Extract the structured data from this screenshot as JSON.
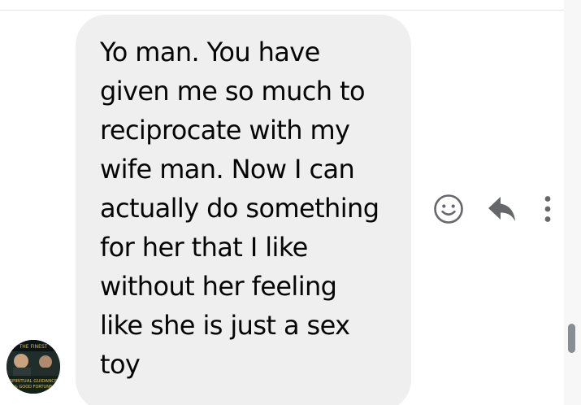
{
  "message": {
    "text": "Yo man. You have\ngiven me so much to\nreciprocate with my\nwife man. Now I can\nactually do something\nfor her that I like\nwithout her feeling\nlike she is just a sex\ntoy"
  },
  "avatar": {
    "logo_text_top": "THE FINEST",
    "logo_text_middle": "SPIRITUAL GUIDANCE",
    "logo_text_bottom": "& GOOD FORTUNE"
  },
  "actions": {
    "react_icon": "smiley-face-icon",
    "reply_icon": "reply-arrow-icon",
    "more_icon": "vertical-ellipsis-icon"
  },
  "colors": {
    "bubble_bg": "#efefef",
    "text": "#050505",
    "icon": "#65676b",
    "scroll_thumb": "#8a8d91"
  }
}
